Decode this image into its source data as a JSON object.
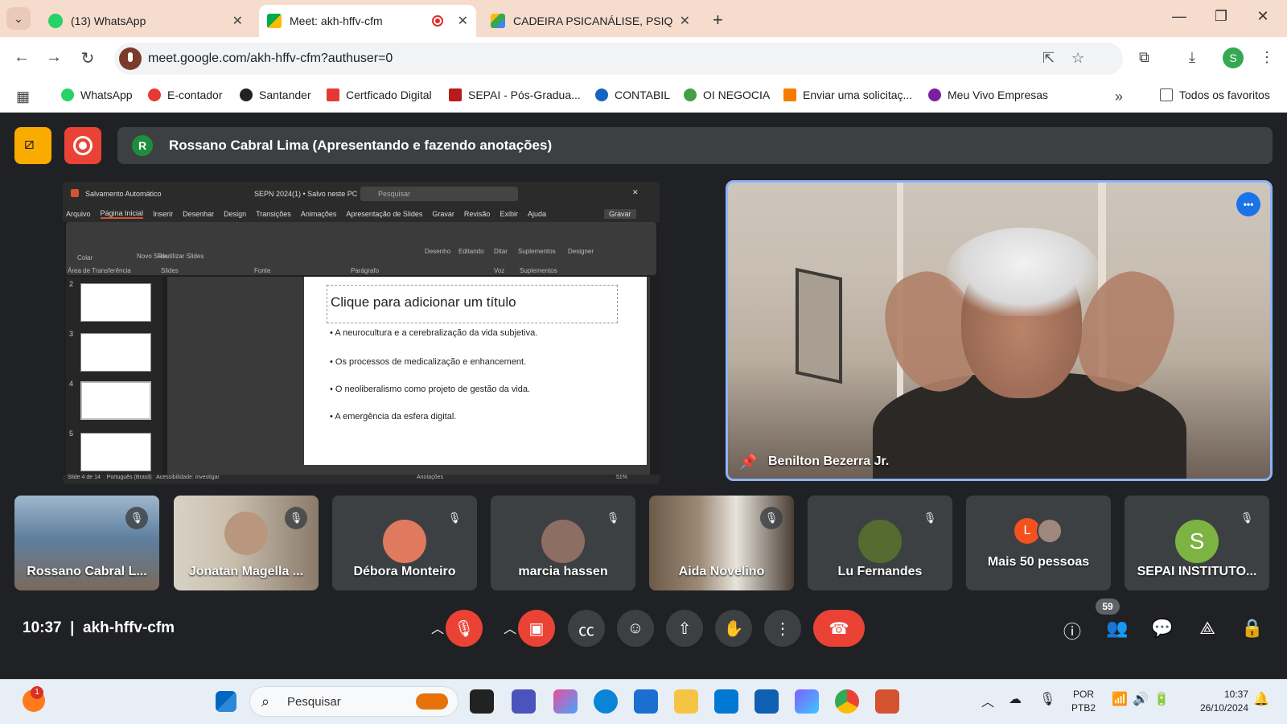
{
  "browser": {
    "tabs": [
      {
        "title": "(13) WhatsApp",
        "active": false,
        "favicon": "whatsapp-icon"
      },
      {
        "title": "Meet: akh-hffv-cfm",
        "active": true,
        "favicon": "meet-icon"
      },
      {
        "title": "CADEIRA PSICANÁLISE, PSIQUI/",
        "active": false,
        "favicon": "drive-icon"
      }
    ],
    "url": "meet.google.com/akh-hffv-cfm?authuser=0",
    "profile_initial": "S",
    "bookmarks": [
      {
        "label": "WhatsApp",
        "color": "#25d366"
      },
      {
        "label": "E-contador",
        "color": "#e53935"
      },
      {
        "label": "Santander",
        "color": "#222222"
      },
      {
        "label": "Certficado Digital",
        "color": "#e53935"
      },
      {
        "label": "SEPAI - Pós-Gradua...",
        "color": "#b71c1c"
      },
      {
        "label": "CONTABIL",
        "color": "#1565c0"
      },
      {
        "label": "OI NEGOCIA",
        "color": "#43a047"
      },
      {
        "label": "Enviar uma solicitaç...",
        "color": "#f57c00"
      },
      {
        "label": "Meu Vivo Empresas",
        "color": "#7b1fa2"
      }
    ],
    "all_bookmarks": "Todos os favoritos"
  },
  "meet": {
    "presenter_initial": "R",
    "presenting_text": "Rossano Cabral Lima (Apresentando e fazendo anotações)",
    "presentation": {
      "app_title": "SEPN 2024(1) • Salvo neste PC",
      "autosave": "Salvamento Automático",
      "search_placeholder": "Pesquisar",
      "menu": [
        "Arquivo",
        "Página Inicial",
        "Inserir",
        "Desenhar",
        "Design",
        "Transições",
        "Animações",
        "Apresentação de Slides",
        "Gravar",
        "Revisão",
        "Exibir",
        "Ajuda"
      ],
      "record_btn": "Gravar",
      "ribbon_groups": [
        "Área de Transferência",
        "Slides",
        "Fonte",
        "Parágrafo",
        "Voz",
        "Suplementos"
      ],
      "ribbon_tools": [
        "Colar",
        "Novo Slide",
        "Reutilizar Slides",
        "Desenho",
        "Editando",
        "Ditar",
        "Suplementos",
        "Designer"
      ],
      "thumb_numbers": [
        "2",
        "3",
        "4",
        "5"
      ],
      "slide_title": "Clique para adicionar um título",
      "bullets": [
        "A neurocultura e a cerebralização da vida subjetiva.",
        "Os processos de medicalização e enhancement.",
        "O neoliberalismo como projeto de gestão da vida.",
        "A emergência da esfera digital."
      ],
      "status_left": "Slide 4 de 14",
      "status_lang": "Português (Brasil)",
      "status_access": "Acessibilidade: investigar",
      "status_notes": "Anotações",
      "zoom": "51%"
    },
    "speaker_name": "Benilton Bezerra Jr.",
    "participants": [
      {
        "name": "Rossano Cabral L...",
        "avatar": "video",
        "color": "#6b8fb3"
      },
      {
        "name": "Jonatan Magella ...",
        "avatar": "video",
        "color": "#8a7a6a"
      },
      {
        "name": "Débora Monteiro",
        "avatar": "photo",
        "color": "#e07a5f"
      },
      {
        "name": "marcia hassen",
        "avatar": "photo",
        "color": "#8d6e63"
      },
      {
        "name": "Aida Novelino",
        "avatar": "video",
        "color": "#7d6b5a"
      },
      {
        "name": "Lu Fernandes",
        "avatar": "photo",
        "color": "#556b2f"
      },
      {
        "name": "Mais 50 pessoas",
        "avatar": "group",
        "color": "#f4511e"
      },
      {
        "name": "SEPAI INSTITUTO...",
        "avatar": "letter",
        "color": "#7cb342"
      }
    ],
    "more_people_initial": "L",
    "sepai_initial": "S",
    "time": "10:37",
    "meeting_code": "akh-hffv-cfm",
    "people_count": "59"
  },
  "taskbar": {
    "notification_count": "1",
    "search_placeholder": "Pesquisar",
    "lang_line1": "POR",
    "lang_line2": "PTB2",
    "clock_time": "10:37",
    "clock_date": "26/10/2024"
  }
}
